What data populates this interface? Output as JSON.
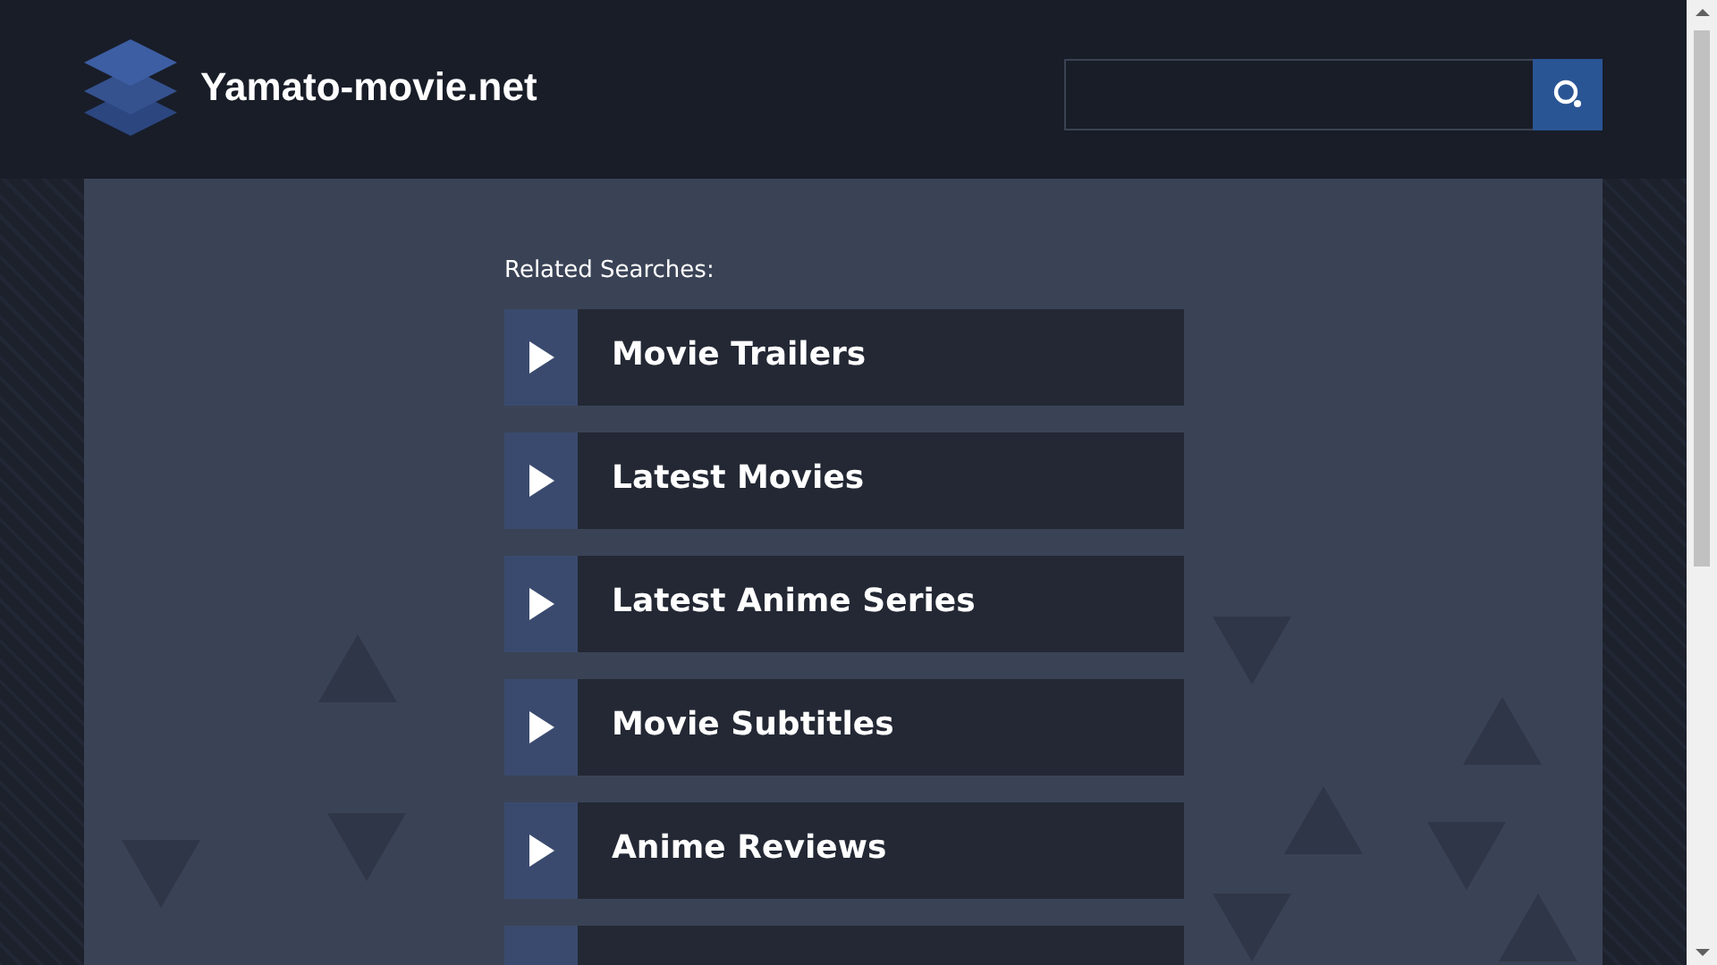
{
  "site": {
    "name": "Yamato-movie.net"
  },
  "related": {
    "heading": "Related Searches:",
    "items": [
      {
        "kind": "link",
        "label": "Movie Trailers"
      },
      {
        "kind": "link",
        "label": "Latest Movies"
      },
      {
        "kind": "link",
        "label": "Latest Anime Series"
      },
      {
        "kind": "link",
        "label": "Movie Subtitles"
      },
      {
        "kind": "link",
        "label": "Anime Reviews"
      },
      {
        "kind": "cut"
      }
    ]
  }
}
